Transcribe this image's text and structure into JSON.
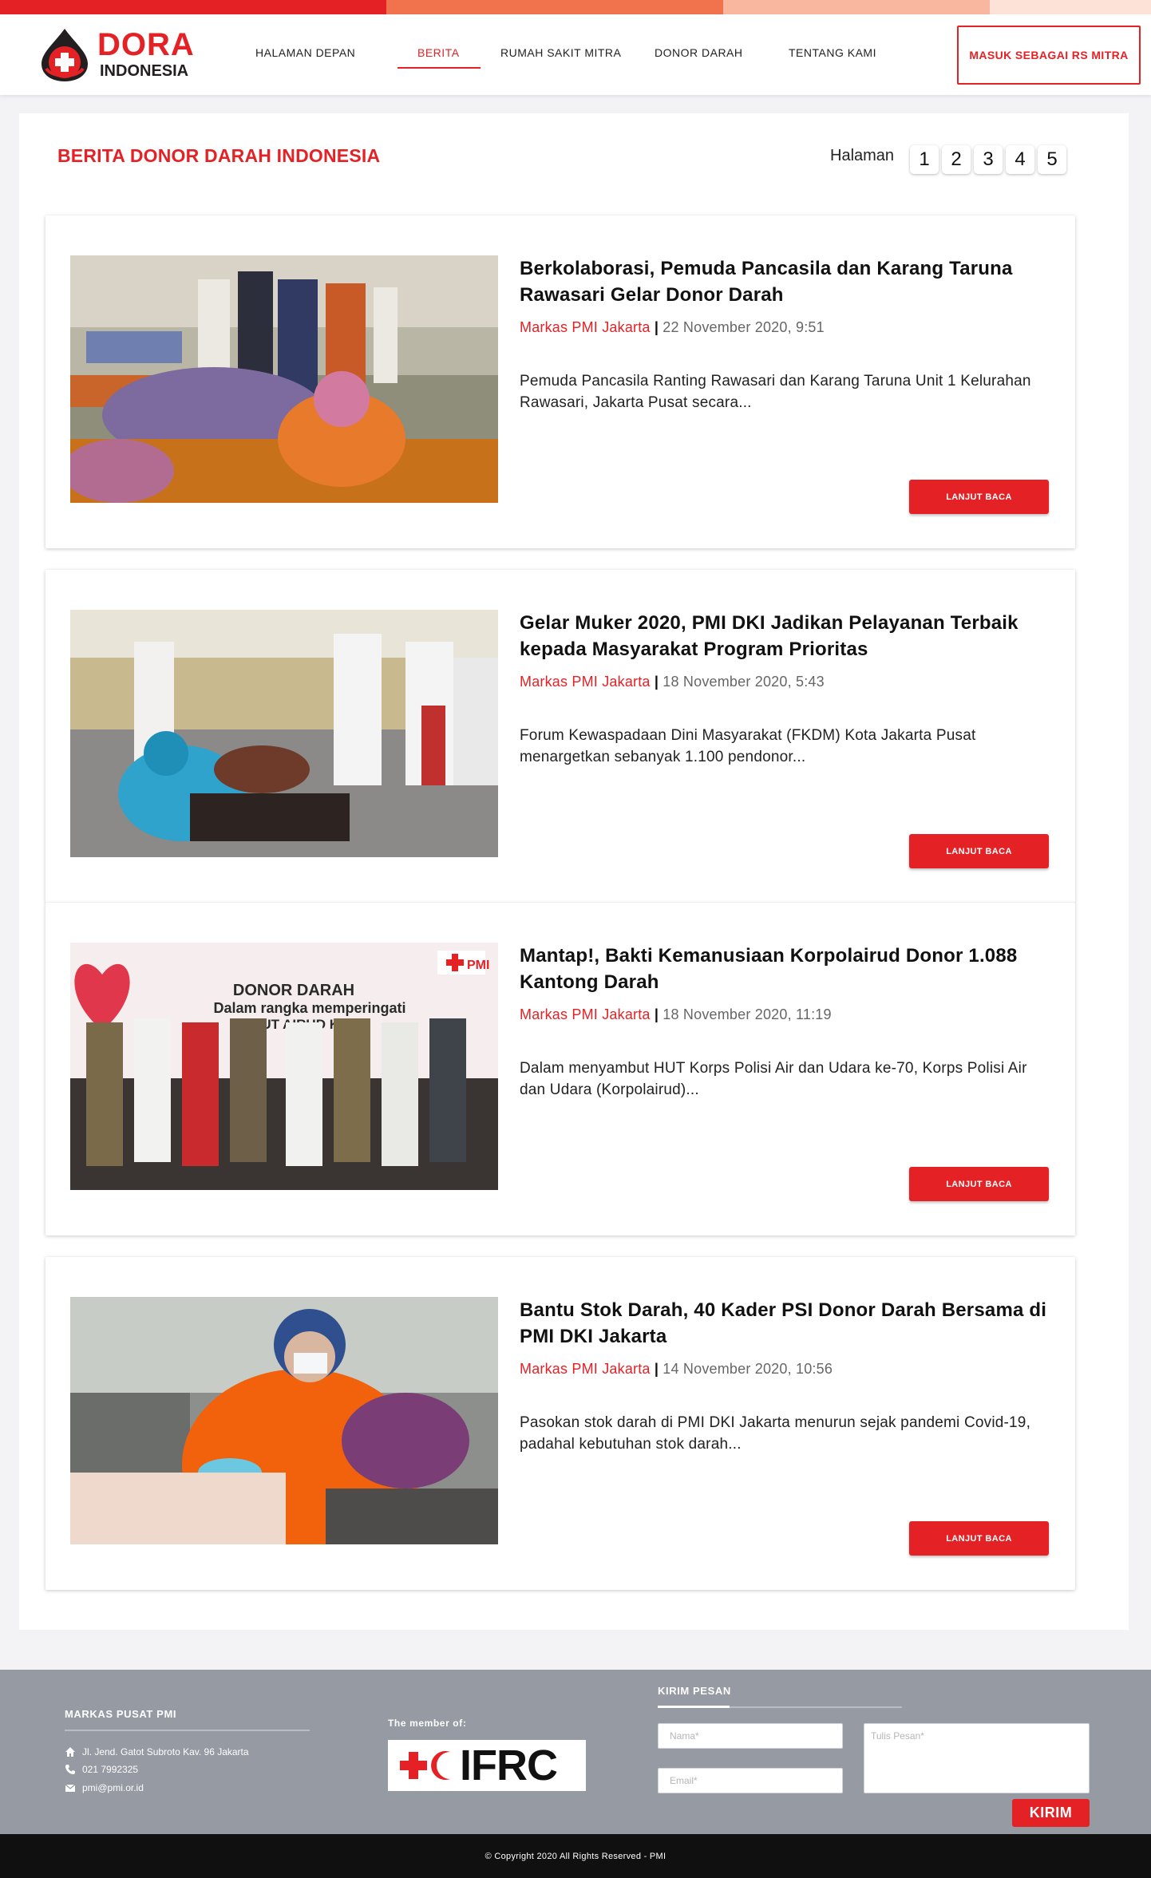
{
  "brand": {
    "name": "DORA",
    "sub": "INDONESIA",
    "accent": "#e42226",
    "strip_colors": [
      "#e42226",
      "#f1734e",
      "#f9b79f",
      "#fde2d7"
    ]
  },
  "nav": {
    "items": [
      {
        "label": "HALAMAN DEPAN"
      },
      {
        "label": "BERITA"
      },
      {
        "label": "RUMAH SAKIT MITRA"
      },
      {
        "label": "DONOR DARAH"
      },
      {
        "label": "TENTANG KAMI"
      }
    ],
    "active": "BERITA",
    "cta": "MASUK SEBAGAI RS MITRA"
  },
  "page": {
    "title": "BERITA DONOR DARAH INDONESIA",
    "pagination_label": "Halaman",
    "pages": [
      "1",
      "2",
      "3",
      "4",
      "5"
    ]
  },
  "articles": [
    {
      "title": "Berkolaborasi, Pemuda Pancasila dan Karang Taruna Rawasari Gelar Donor Darah",
      "source": "Markas PMI Jakarta",
      "separator": "|",
      "date": "22 November 2020, 9:51",
      "excerpt": "Pemuda Pancasila Ranting Rawasari dan Karang Taruna Unit 1 Kelurahan Rawasari, Jakarta Pusat secara...",
      "button": "LANJUT BACA"
    },
    {
      "title": "Gelar Muker 2020, PMI DKI Jadikan Pelayanan Terbaik kepada Masyarakat Program Prioritas",
      "source": "Markas PMI Jakarta",
      "separator": "|",
      "date": "18 November 2020, 5:43",
      "excerpt": "Forum Kewaspadaan Dini Masyarakat (FKDM) Kota Jakarta Pusat menargetkan sebanyak 1.100 pendonor...",
      "button": "LANJUT BACA"
    },
    {
      "title": "Mantap!, Bakti Kemanusiaan Korpolairud Donor 1.088 Kantong Darah",
      "source": "Markas PMI Jakarta",
      "separator": "|",
      "date": "18 November 2020, 11:19",
      "excerpt": "Dalam menyambut HUT Korps Polisi Air dan Udara ke-70, Korps Polisi Air dan Udara (Korpolairud)...",
      "button": "LANJUT BACA"
    },
    {
      "title": "Bantu Stok Darah, 40 Kader PSI Donor Darah Bersama di PMI DKI Jakarta",
      "source": "Markas PMI Jakarta",
      "separator": "|",
      "date": "14 November 2020, 10:56",
      "excerpt": "Pasokan stok darah di PMI DKI Jakarta menurun sejak pandemi Covid-19, padahal kebutuhan stok darah...",
      "button": "LANJUT BACA"
    }
  ],
  "image3_text": {
    "line1": "DONOR DARAH",
    "line2": "Dalam rangka memperingati",
    "line3": "HUT AIRUD KE-70",
    "pmi": "PMI"
  },
  "footer": {
    "hq_heading": "MARKAS PUSAT PMI",
    "address": "Jl. Jend. Gatot Subroto Kav. 96 Jakarta",
    "phone": "021 7992325",
    "email": "pmi@pmi.or.id",
    "member_heading": "The member of:",
    "member_logo_text": "IFRC",
    "message_heading": "KIRIM PESAN",
    "name_placeholder": "Nama*",
    "email_placeholder": "Email*",
    "message_placeholder": "Tulis Pesan*",
    "send_button": "KIRIM",
    "copyright": "© Copyright 2020 All Rights Reserved - PMI"
  }
}
